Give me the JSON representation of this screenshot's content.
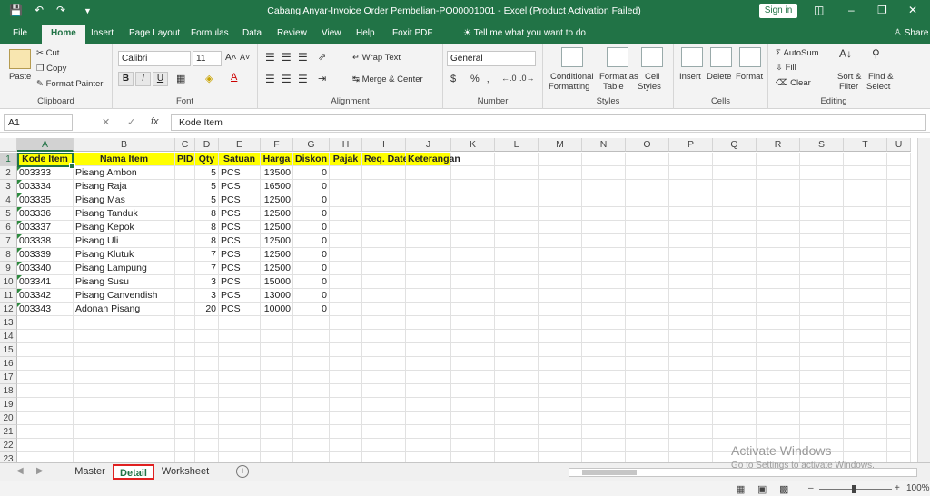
{
  "window": {
    "title": "Cabang Anyar-Invoice Order Pembelian-PO00001001  -  Excel (Product Activation Failed)",
    "signin_label": "Sign in"
  },
  "ribbon_tabs": [
    "File",
    "Home",
    "Insert",
    "Page Layout",
    "Formulas",
    "Data",
    "Review",
    "View",
    "Help",
    "Foxit PDF"
  ],
  "tell_me": "Tell me what you want to do",
  "share_label": "Share",
  "clipboard": {
    "paste": "Paste",
    "cut": "Cut",
    "copy": "Copy",
    "format_painter": "Format Painter",
    "label": "Clipboard"
  },
  "font": {
    "name": "Calibri",
    "size": "11",
    "label": "Font",
    "bold": "B",
    "italic": "I",
    "underline": "U"
  },
  "alignment": {
    "wrap": "Wrap Text",
    "merge": "Merge & Center",
    "label": "Alignment"
  },
  "number": {
    "format": "General",
    "label": "Number",
    "currency": "$",
    "percent": "%"
  },
  "styles": {
    "conditional1": "Conditional",
    "conditional2": "Formatting",
    "format_table1": "Format as",
    "format_table2": "Table",
    "cell_styles1": "Cell",
    "cell_styles2": "Styles",
    "label": "Styles"
  },
  "cells": {
    "insert": "Insert",
    "delete": "Delete",
    "format": "Format",
    "label": "Cells"
  },
  "editing": {
    "autosum": "AutoSum",
    "fill": "Fill",
    "clear": "Clear",
    "sort1": "Sort &",
    "sort2": "Filter",
    "find1": "Find &",
    "find2": "Select",
    "label": "Editing"
  },
  "formula_bar": {
    "name_box": "A1",
    "fx": "fx",
    "content": "Kode Item"
  },
  "columns": [
    "A",
    "B",
    "C",
    "D",
    "E",
    "F",
    "G",
    "H",
    "I",
    "J",
    "K",
    "L",
    "M",
    "N",
    "O",
    "P",
    "Q",
    "R",
    "S",
    "T",
    "U"
  ],
  "rows": [
    "1",
    "2",
    "3",
    "4",
    "5",
    "6",
    "7",
    "8",
    "9",
    "10",
    "11",
    "12",
    "13",
    "14",
    "15",
    "16",
    "17",
    "18",
    "19",
    "20",
    "21",
    "22",
    "23"
  ],
  "header_row": [
    "Kode Item",
    "Nama Item",
    "PID",
    "Qty",
    "Satuan",
    "Harga",
    "Diskon",
    "Pajak",
    "Req. Date",
    "Keterangan"
  ],
  "data_rows": [
    [
      "003333",
      "Pisang Ambon",
      "",
      "5",
      "PCS",
      "13500",
      "0"
    ],
    [
      "003334",
      "Pisang Raja",
      "",
      "5",
      "PCS",
      "16500",
      "0"
    ],
    [
      "003335",
      "Pisang Mas",
      "",
      "5",
      "PCS",
      "12500",
      "0"
    ],
    [
      "003336",
      "Pisang Tanduk",
      "",
      "8",
      "PCS",
      "12500",
      "0"
    ],
    [
      "003337",
      "Pisang Kepok",
      "",
      "8",
      "PCS",
      "12500",
      "0"
    ],
    [
      "003338",
      "Pisang Uli",
      "",
      "8",
      "PCS",
      "12500",
      "0"
    ],
    [
      "003339",
      "Pisang Klutuk",
      "",
      "7",
      "PCS",
      "12500",
      "0"
    ],
    [
      "003340",
      "Pisang Lampung",
      "",
      "7",
      "PCS",
      "12500",
      "0"
    ],
    [
      "003341",
      "Pisang Susu",
      "",
      "3",
      "PCS",
      "15000",
      "0"
    ],
    [
      "003342",
      "Pisang Canvendish",
      "",
      "3",
      "PCS",
      "13000",
      "0"
    ],
    [
      "003343",
      "Adonan Pisang",
      "",
      "20",
      "PCS",
      "10000",
      "0"
    ]
  ],
  "sheet_tabs": [
    "Master",
    "Detail",
    "Worksheet"
  ],
  "active_sheet": "Detail",
  "watermark": {
    "line1": "Activate Windows",
    "line2": "Go to Settings to activate Windows."
  },
  "zoom": "100%",
  "colors": {
    "accent": "#217346",
    "header_fill": "#ffff00",
    "active_tab_outline": "#e02020"
  }
}
